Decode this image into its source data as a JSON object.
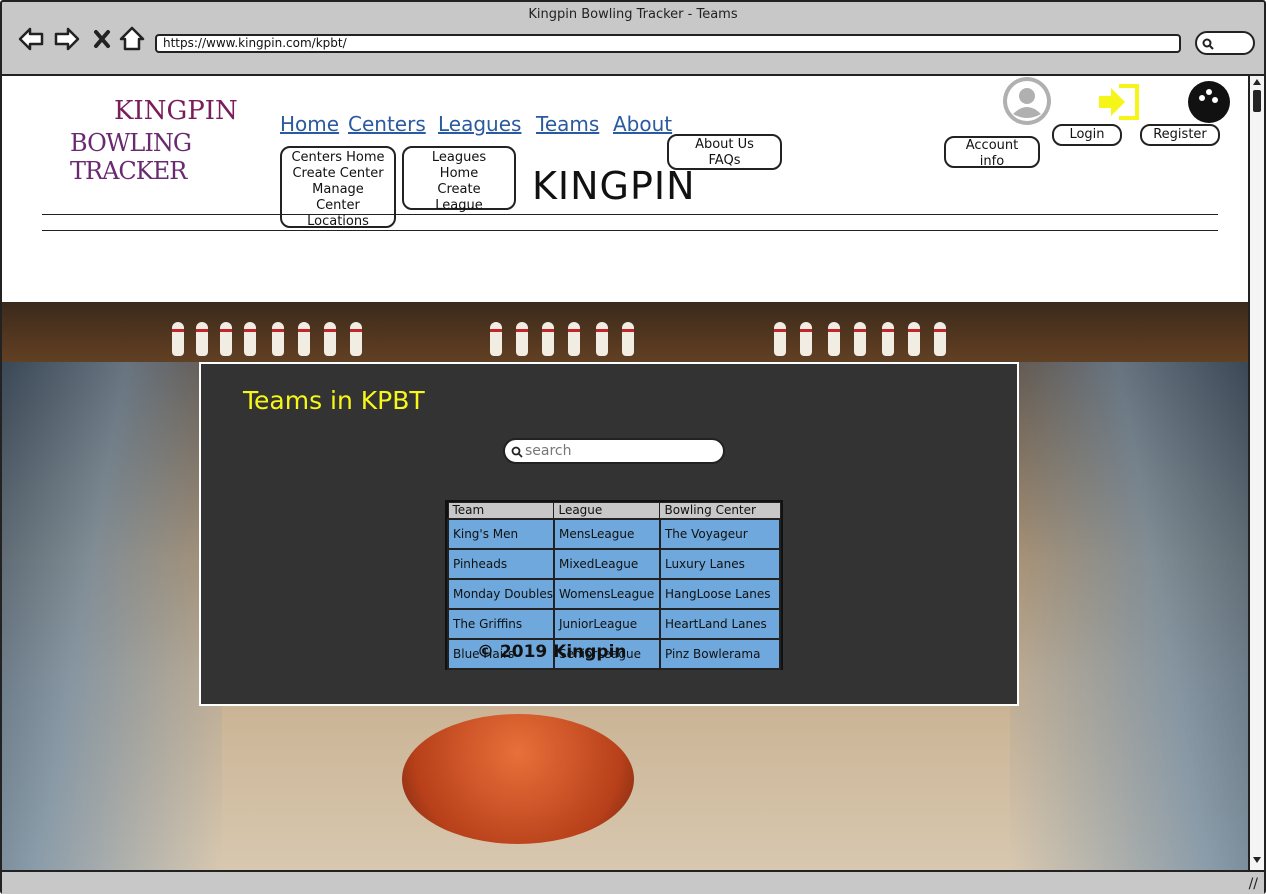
{
  "window": {
    "title": "Kingpin Bowling Tracker - Teams"
  },
  "browser": {
    "url": "https://www.kingpin.com/kpbt/"
  },
  "logo": {
    "line1": "KINGPIN",
    "line2": "BOWLING TRACKER"
  },
  "nav": {
    "home": "Home",
    "centers": "Centers",
    "leagues": "Leagues",
    "teams": "Teams",
    "about": "About"
  },
  "menus": {
    "centers": [
      "Centers Home",
      "Create Center",
      "Manage",
      "Center",
      "Locations"
    ],
    "leagues": [
      "Leagues",
      "Home",
      "Create",
      "League"
    ],
    "about": [
      "About Us",
      "FAQs"
    ]
  },
  "account": {
    "info_line1": "Account",
    "info_line2": "info",
    "login": "Login",
    "register": "Register"
  },
  "site_title": "KINGPIN",
  "panel": {
    "title": "Teams in KPBT",
    "search_placeholder": "search",
    "columns": [
      "Team",
      "League",
      "Bowling Center"
    ],
    "rows": [
      [
        "King's Men",
        "MensLeague",
        "The Voyageur"
      ],
      [
        "Pinheads",
        "MixedLeague",
        "Luxury Lanes"
      ],
      [
        "Monday Doubles",
        "WomensLeague",
        "HangLoose Lanes"
      ],
      [
        "The Griffins",
        "JuniorLeague",
        "HeartLand Lanes"
      ],
      [
        "Blue Hairs",
        "SeniorLeague",
        "Pinz Bowlerama"
      ]
    ]
  },
  "footer": "© 2019 Kingpin",
  "colors": {
    "panel_bg": "#333333",
    "title_yellow": "#f7f71a",
    "cell_blue": "#6fa8dc",
    "header_gray": "#c8c8c8",
    "link_blue": "#2a5aa0"
  },
  "icons": [
    "back-arrow-icon",
    "forward-arrow-icon",
    "close-icon",
    "home-icon",
    "search-icon",
    "user-avatar-icon",
    "login-icon",
    "bowling-ball-icon"
  ]
}
